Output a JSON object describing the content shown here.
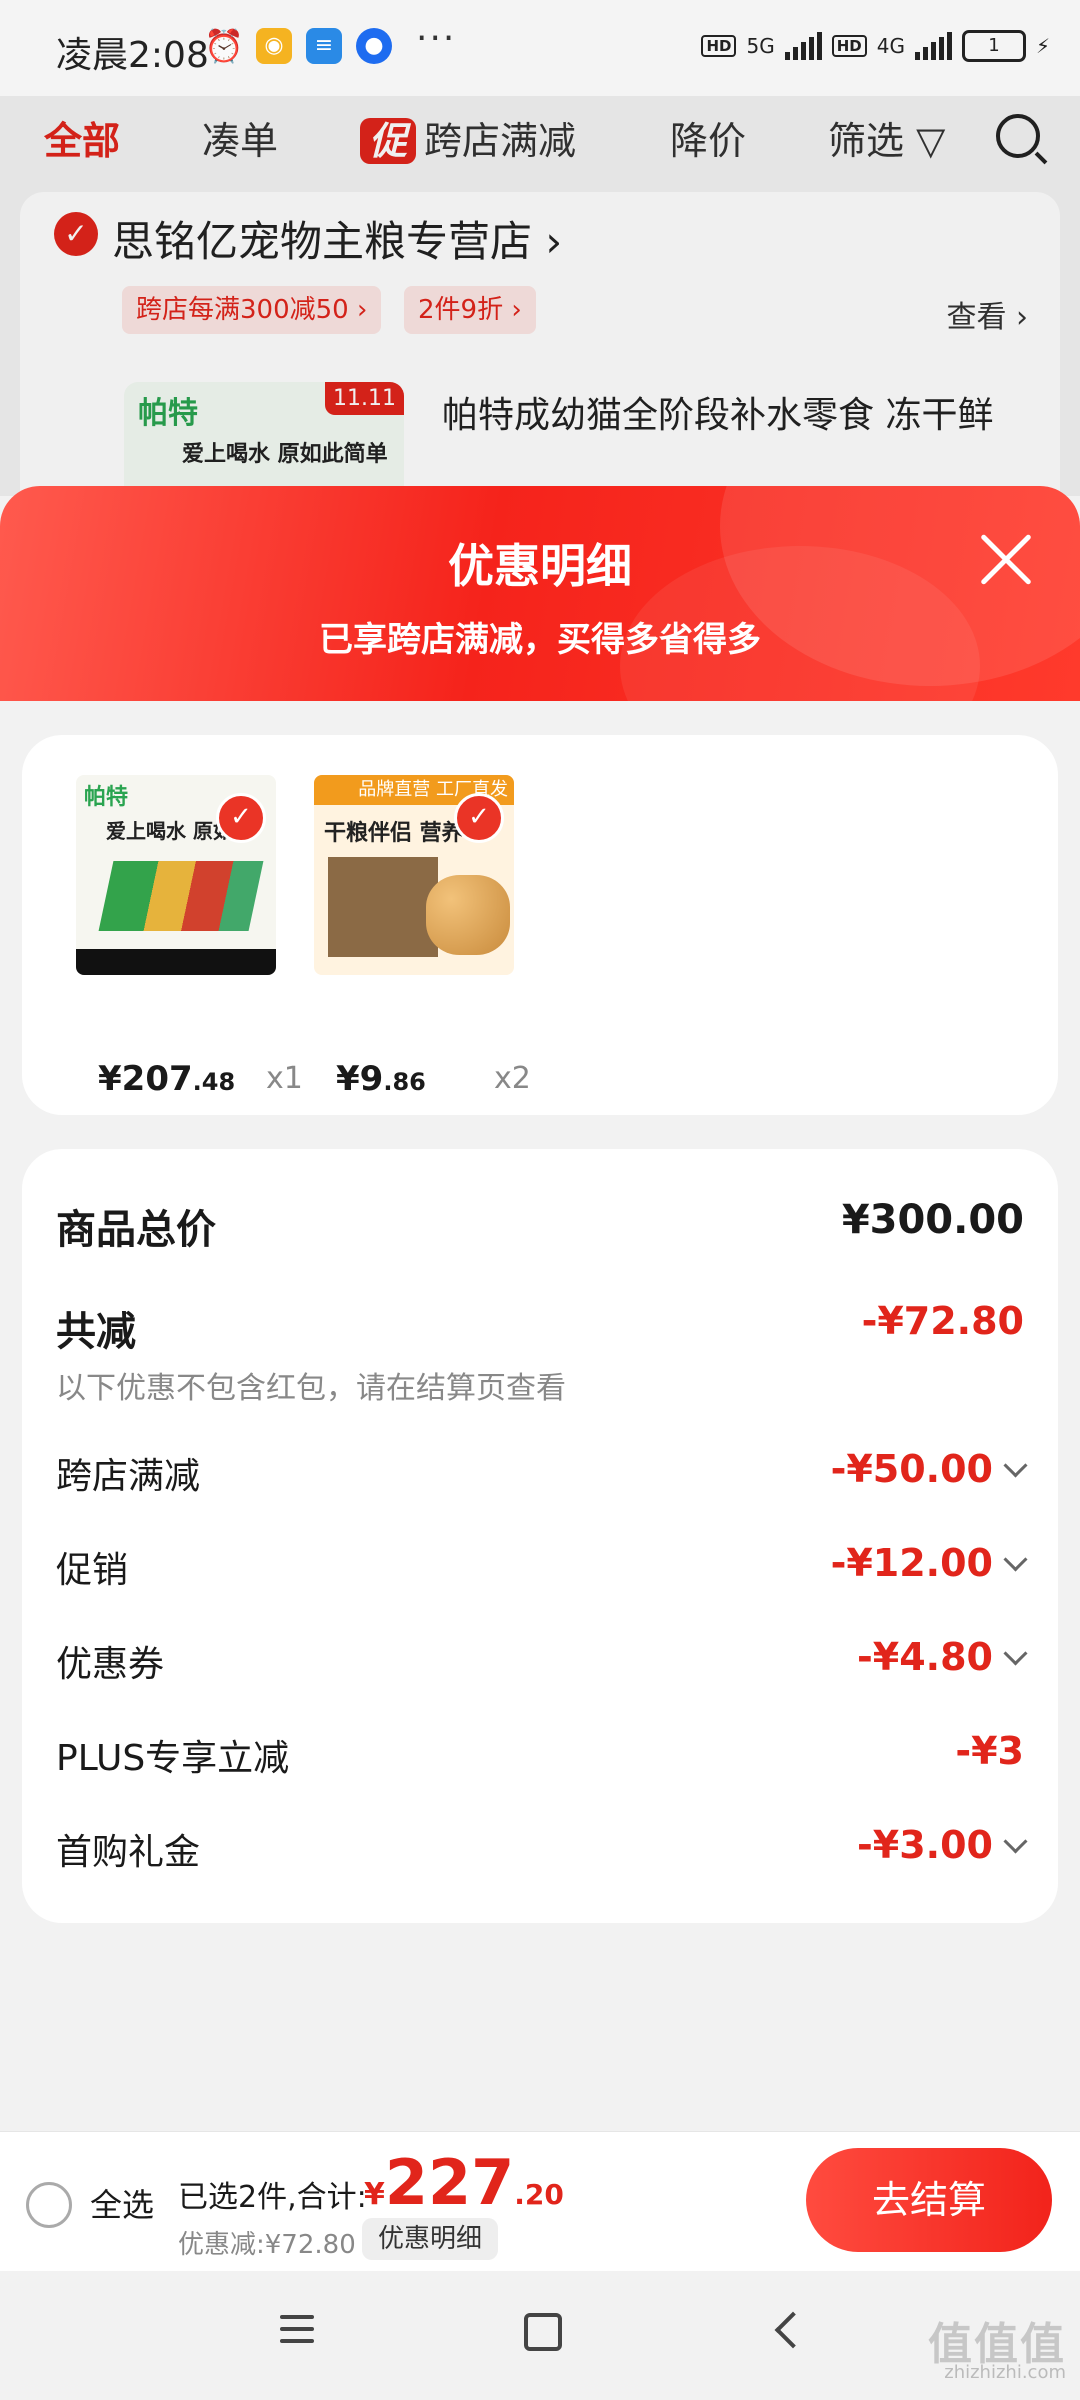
{
  "status_bar": {
    "time": "凌晨2:08",
    "network_1": "5G",
    "network_2": "4G",
    "hd_label": "HD",
    "battery": "1",
    "more": "···"
  },
  "background": {
    "tabs": [
      "全部",
      "凑单",
      "跨店满减",
      "降价",
      "筛选"
    ],
    "promo_badge": "促",
    "store_name": "思铭亿宠物主粮专营店 ›",
    "promo_chips": [
      "跨店每满300减50 ›",
      "2件9折 ›"
    ],
    "view_link": "查看 ›",
    "thumb_brand": "帕特",
    "thumb_tag": "11.11",
    "thumb_slogan": "爱上喝水 原如此简单",
    "product_title": "帕特成幼猫全阶段补水零食 冻干鲜"
  },
  "sheet": {
    "title": "优惠明细",
    "subtitle": "已享跨店满减，买得多省得多"
  },
  "products": [
    {
      "brand": "帕特",
      "slogan": "爱上喝水 原如",
      "price_int": "¥207",
      "price_dec": ".48",
      "qty": "x1"
    },
    {
      "banner": "品牌直营 工厂直发",
      "slogan": "干粮伴侣 营养",
      "price_int": "¥9",
      "price_dec": ".86",
      "qty": "x2"
    }
  ],
  "summary": {
    "total_label": "商品总价",
    "total_value": "¥300.00",
    "reduce_label": "共减",
    "reduce_value": "-¥72.80",
    "note": "以下优惠不包含红包，请在结算页查看",
    "items": [
      {
        "label": "跨店满减",
        "value": "-¥50.00"
      },
      {
        "label": "促销",
        "value": "-¥12.00"
      },
      {
        "label": "优惠券",
        "value": "-¥4.80"
      },
      {
        "label": "PLUS专享立减",
        "value": "-¥3"
      },
      {
        "label": "首购礼金",
        "value": "-¥3.00"
      }
    ]
  },
  "bottom": {
    "select_all": "全选",
    "selected_count": "已选2件,合计:",
    "currency": "¥",
    "total_int": "227",
    "total_dec": ".20",
    "discount": "优惠减:¥72.80",
    "detail_button": "优惠明细",
    "checkout": "去结算"
  },
  "watermark": {
    "main": "值值值",
    "sub": "zhizhizhi.com"
  },
  "colors": {
    "accent": "#e1251b",
    "header_gradient_end": "#ff3a2c"
  }
}
